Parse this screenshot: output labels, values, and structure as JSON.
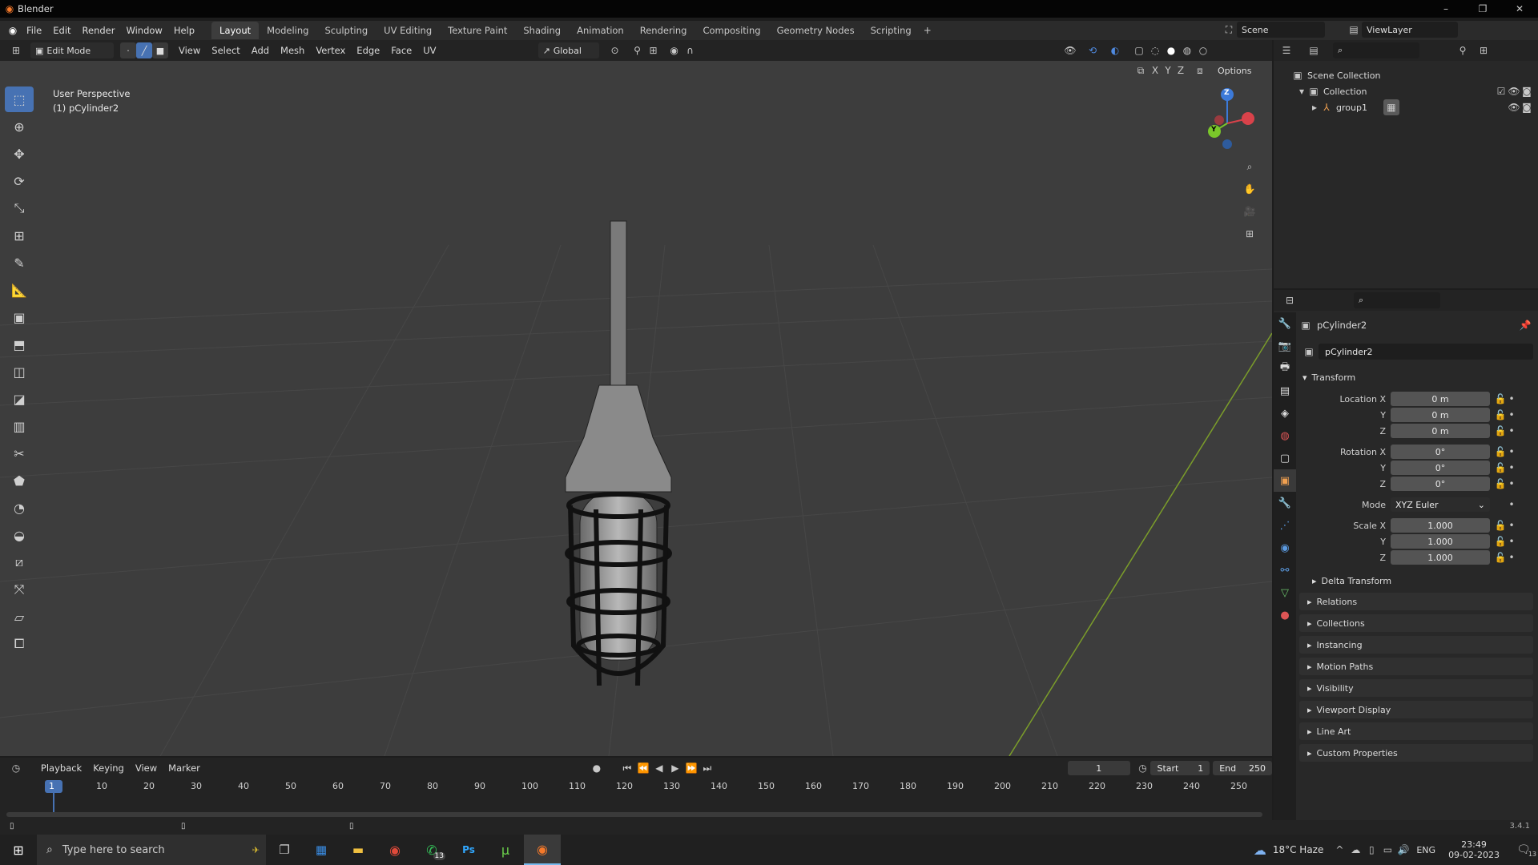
{
  "title": {
    "app": "Blender"
  },
  "menu": [
    "File",
    "Edit",
    "Render",
    "Window",
    "Help"
  ],
  "workspaces": [
    "Layout",
    "Modeling",
    "Sculpting",
    "UV Editing",
    "Texture Paint",
    "Shading",
    "Animation",
    "Rendering",
    "Compositing",
    "Geometry Nodes",
    "Scripting"
  ],
  "scene": {
    "name": "Scene",
    "view_layer": "ViewLayer"
  },
  "viewport_header": {
    "mode": "Edit Mode",
    "menus": [
      "View",
      "Select",
      "Add",
      "Mesh",
      "Vertex",
      "Edge",
      "Face",
      "UV"
    ],
    "orientation": "Global",
    "options": "Options",
    "axes": [
      "X",
      "Y",
      "Z"
    ]
  },
  "viewport": {
    "perspective": "User Perspective",
    "object": "(1) pCylinder2",
    "gizmo": {
      "z": "Z",
      "y": "Y"
    }
  },
  "outliner": {
    "scene_collection": "Scene Collection",
    "collection": "Collection",
    "group": "group1"
  },
  "properties": {
    "object_name": "pCylinder2",
    "data_name": "pCylinder2",
    "transform_label": "Transform",
    "location": {
      "label": "Location X",
      "x": "0 m",
      "y": "0 m",
      "z": "0 m"
    },
    "rotation": {
      "label": "Rotation X",
      "x": "0°",
      "y": "0°",
      "z": "0°"
    },
    "mode_label": "Mode",
    "mode_value": "XYZ Euler",
    "scale": {
      "label": "Scale X",
      "x": "1.000",
      "y": "1.000",
      "z": "1.000"
    },
    "axis_y": "Y",
    "axis_z": "Z",
    "delta": "Delta Transform",
    "sections": [
      "Relations",
      "Collections",
      "Instancing",
      "Motion Paths",
      "Visibility",
      "Viewport Display",
      "Line Art",
      "Custom Properties"
    ]
  },
  "timeline": {
    "menus": [
      "Playback",
      "Keying",
      "View",
      "Marker"
    ],
    "current_frame": "1",
    "start_label": "Start",
    "start": "1",
    "end_label": "End",
    "end": "250",
    "ticks": [
      "1",
      "10",
      "20",
      "30",
      "40",
      "50",
      "60",
      "70",
      "80",
      "90",
      "100",
      "110",
      "120",
      "130",
      "140",
      "150",
      "160",
      "170",
      "180",
      "190",
      "200",
      "210",
      "220",
      "230",
      "240",
      "250"
    ]
  },
  "status": {
    "version": "3.4.1"
  },
  "taskbar": {
    "search_placeholder": "Type here to search",
    "weather": "18°C Haze",
    "lang": "ENG",
    "time": "23:49",
    "date": "09-02-2023",
    "whatsapp_badge": "13",
    "notifications": "13"
  },
  "colors": {
    "accent": "#4772b3",
    "bg": "#3d3d3d",
    "panel": "#282828",
    "frame_marker": "#4772b3"
  }
}
